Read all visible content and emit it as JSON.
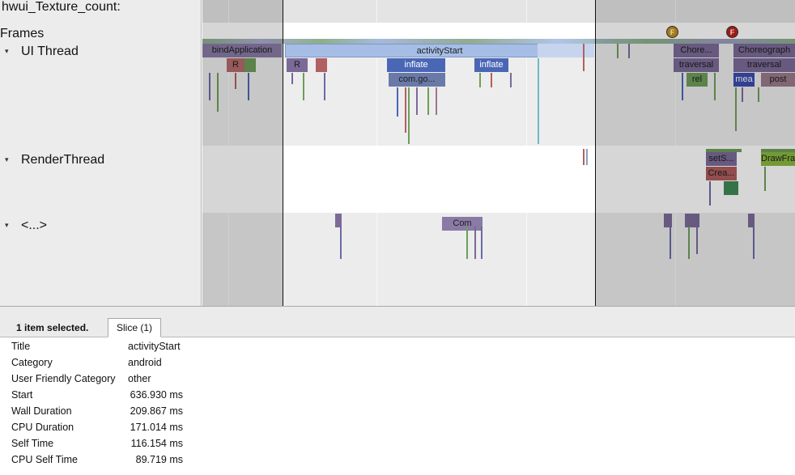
{
  "tracks": {
    "counter_label": "hwui_Texture_count:",
    "frames_label": "Frames",
    "ui_thread_label": "UI Thread",
    "render_thread_label": "RenderThread",
    "other_label": "<...>",
    "frame_markers": [
      "F",
      "F"
    ],
    "slices": {
      "bind_application": "bindApplication",
      "r1": "R",
      "r2": "R",
      "activity_start": "activityStart",
      "inflate1": "inflate",
      "inflate2": "inflate",
      "com_go": "com.go...",
      "chore": "Chore...",
      "choreograph": "Choreograph",
      "traversal1": "traversal",
      "traversal2": "traversal",
      "rel": "rel",
      "mea": "mea",
      "post": "post",
      "sets": "setS...",
      "crea": "Crea...",
      "drawfra": "DrawFra",
      "com": "Com"
    }
  },
  "panel": {
    "selected_count": "1 item selected.",
    "tab_label": "Slice (1)",
    "rows": [
      {
        "key": "Title",
        "value": "activityStart"
      },
      {
        "key": "Category",
        "value": "android"
      },
      {
        "key": "User Friendly Category",
        "value": "other"
      },
      {
        "key": "Start",
        "value": "636.930 ms"
      },
      {
        "key": "Wall Duration",
        "value": "209.867 ms"
      },
      {
        "key": "CPU Duration",
        "value": "171.014 ms"
      },
      {
        "key": "Self Time",
        "value": "116.154 ms"
      },
      {
        "key": "CPU Self Time",
        "value": "89.719 ms"
      }
    ]
  },
  "colors": {
    "selected_slice": "#a6bde6",
    "purple_slice": "#7b6a98",
    "blue_slice": "#4a67b5",
    "red_slice": "#b05c5c",
    "green_slice": "#6e9d5a",
    "marker_orange": "#c8901a",
    "marker_red": "#c0201a"
  }
}
